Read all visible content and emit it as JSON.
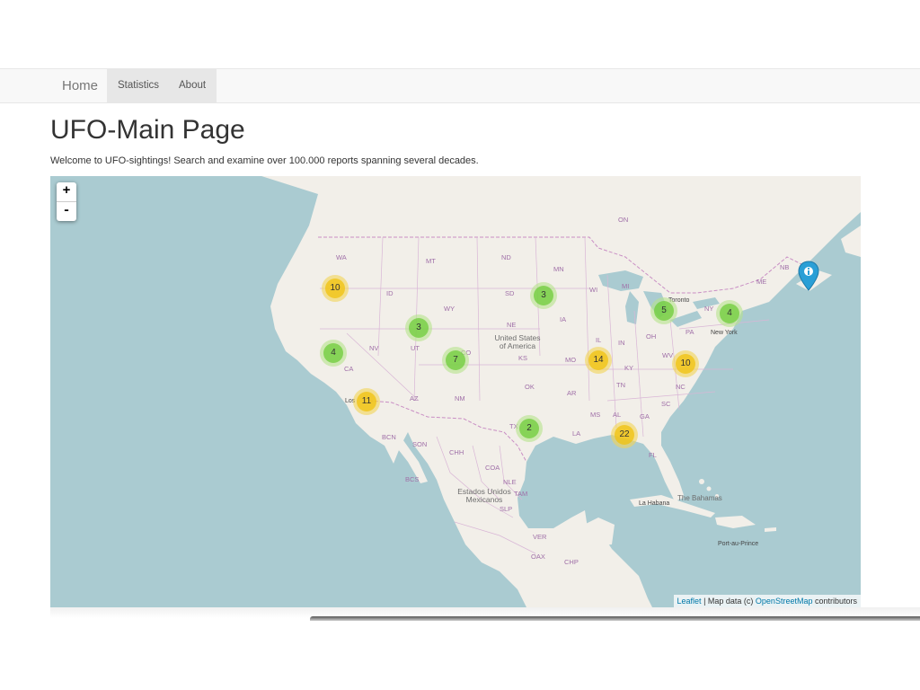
{
  "nav": {
    "brand": "Home",
    "items": [
      {
        "label": "Statistics"
      },
      {
        "label": "About"
      }
    ]
  },
  "page": {
    "title": "UFO-Main Page",
    "intro": "Welcome to UFO-sightings! Search and examine over 100.000 reports spanning several decades."
  },
  "map": {
    "zoom_in": "+",
    "zoom_out": "-",
    "clusters": [
      {
        "count": "10",
        "size": "medium"
      },
      {
        "count": "3",
        "size": "small"
      },
      {
        "count": "4",
        "size": "small"
      },
      {
        "count": "7",
        "size": "small"
      },
      {
        "count": "11",
        "size": "medium"
      },
      {
        "count": "3",
        "size": "small"
      },
      {
        "count": "14",
        "size": "medium"
      },
      {
        "count": "2",
        "size": "small"
      },
      {
        "count": "22",
        "size": "medium"
      },
      {
        "count": "5",
        "size": "small"
      },
      {
        "count": "4",
        "size": "small"
      },
      {
        "count": "10",
        "size": "medium"
      }
    ],
    "state_labels": [
      "WA",
      "MT",
      "ND",
      "MN",
      "ID",
      "SD",
      "WY",
      "WI",
      "MI",
      "NE",
      "IA",
      "NV",
      "UT",
      "CO",
      "KS",
      "MO",
      "IL",
      "IN",
      "OH",
      "PA",
      "NY",
      "CA",
      "AZ",
      "NM",
      "OK",
      "AR",
      "KY",
      "WV",
      "TN",
      "NC",
      "SC",
      "MS",
      "AL",
      "GA",
      "LA",
      "TX",
      "FL",
      "ON",
      "NB",
      "ME",
      "BCN",
      "SON",
      "CHH",
      "COA",
      "BCS",
      "NLE",
      "TAM",
      "SLP",
      "VER",
      "OAX",
      "CHP"
    ],
    "place_labels": [
      "Toronto",
      "New York",
      "Los",
      "La Habana",
      "The Bahamas",
      "Port-au-Prince"
    ],
    "country_labels": [
      "United States of America",
      "Estados Unidos Mexicanos"
    ],
    "info_marker": "info-marker",
    "attribution": {
      "leaflet": "Leaflet",
      "separator": " | Map data (c) ",
      "osm": "OpenStreetMap",
      "suffix": " contributors"
    }
  },
  "colors": {
    "water": "#aacbd1",
    "land": "#f2efe9",
    "cluster_small": "#6ecc39",
    "cluster_medium": "#f0c20c",
    "marker": "#2a9fd6"
  }
}
